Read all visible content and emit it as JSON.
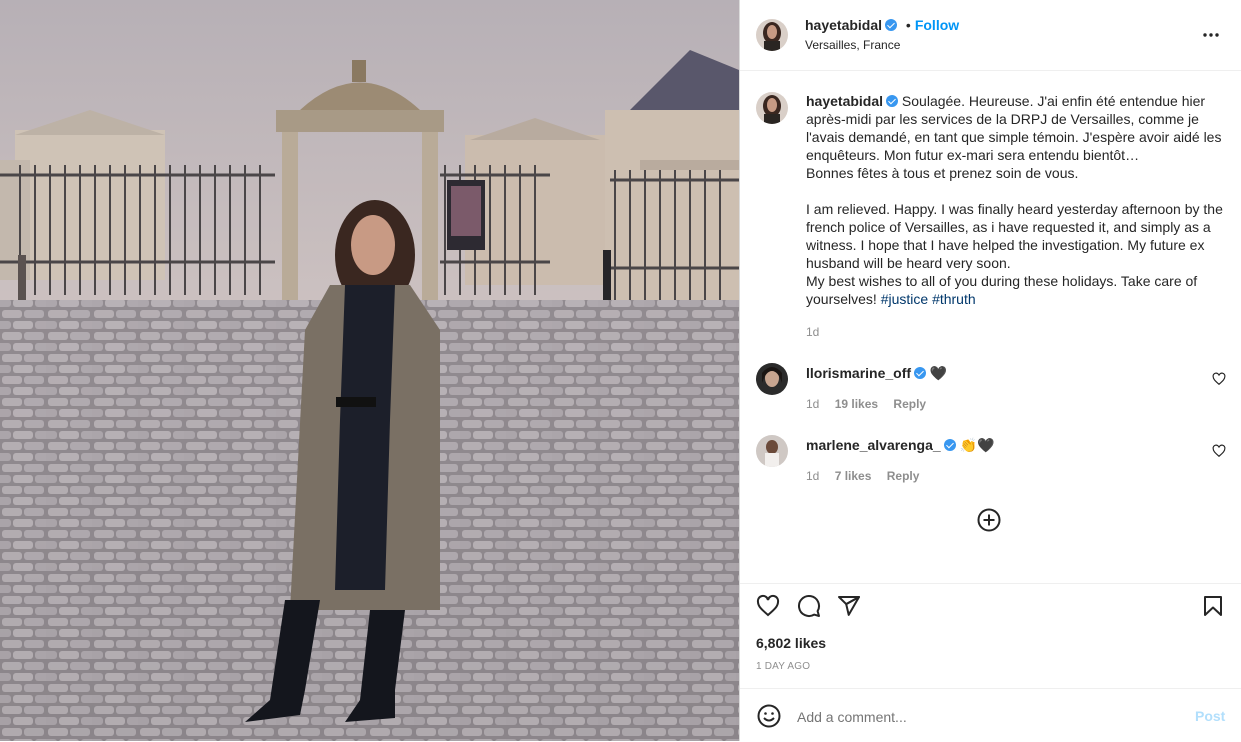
{
  "post": {
    "author": "hayetabidal",
    "location": "Versailles, France",
    "follow_label": "Follow",
    "dot": "•",
    "caption": "Soulagée. Heureuse. J'ai enfin été entendue hier après-midi par les services de la DRPJ de Versailles, comme je l'avais demandé, en tant que simple témoin. J'espère avoir aidé les enquêteurs. Mon futur ex-mari sera entendu bientôt…\nBonnes fêtes à tous et prenez soin de vous.\n\nI am relieved. Happy. I was finally heard yesterday afternoon by the french police of Versailles, as i have requested it, and simply as a witness. I hope that I have helped the investigation. My future ex husband will be heard very soon.\nMy best wishes to all of you during these holidays. Take care of yourselves! ",
    "hashtags": [
      "#justice",
      "#thruth"
    ],
    "caption_age": "1d",
    "likes": "6,802 likes",
    "date": "1 DAY AGO"
  },
  "comments": [
    {
      "user": "llorismarine_off",
      "text": "🖤",
      "age": "1d",
      "likes": "19 likes",
      "reply": "Reply"
    },
    {
      "user": "marlene_alvarenga_",
      "text": "👏🖤",
      "age": "1d",
      "likes": "7 likes",
      "reply": "Reply"
    }
  ],
  "add_comment": {
    "placeholder": "Add a comment...",
    "post_label": "Post"
  },
  "icons": [
    "more-icon",
    "verified-icon",
    "heart-icon",
    "comment-icon",
    "share-icon",
    "bookmark-icon",
    "emoji-icon",
    "load-more-icon"
  ],
  "colors": {
    "accent": "#0095f6",
    "verified": "#3897f0",
    "hashtag": "#00376b",
    "muted": "#8e8e8e"
  }
}
